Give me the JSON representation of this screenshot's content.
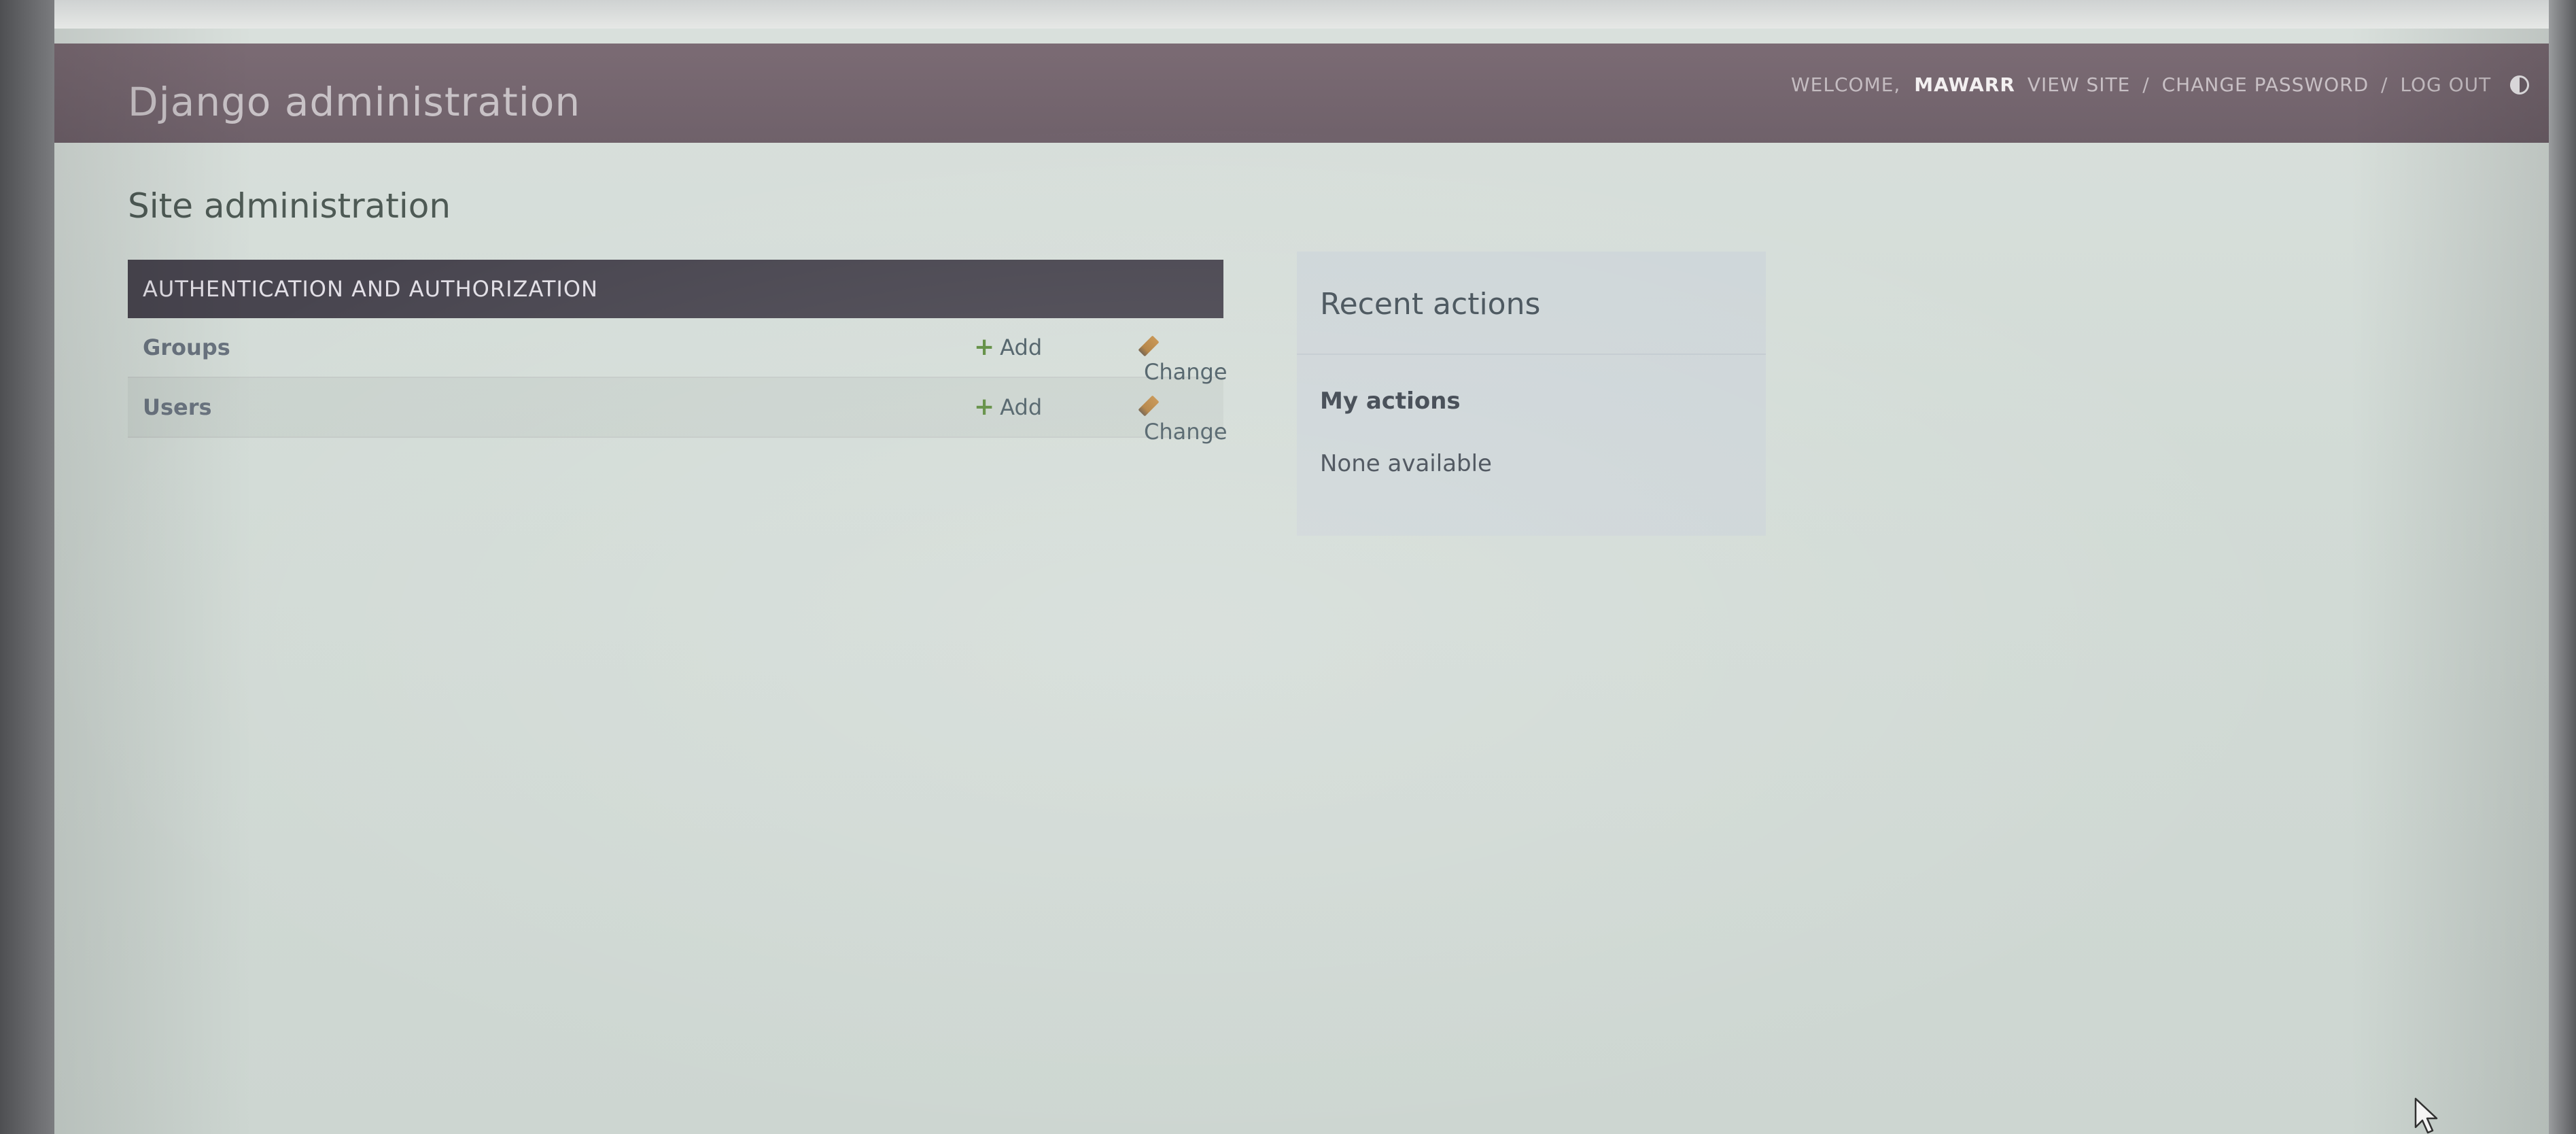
{
  "header": {
    "branding": "Django administration",
    "welcome_label": "WELCOME,",
    "username": "MAWARR",
    "view_site": "VIEW SITE",
    "separator": "/",
    "change_password": "CHANGE PASSWORD",
    "log_out": "LOG OUT",
    "theme_toggle_icon": "half-circle-icon"
  },
  "main": {
    "title": "Site administration",
    "apps": [
      {
        "caption": "AUTHENTICATION AND AUTHORIZATION",
        "models": [
          {
            "name": "Groups",
            "add_label": "Add",
            "change_label": "Change"
          },
          {
            "name": "Users",
            "add_label": "Add",
            "change_label": "Change"
          }
        ]
      }
    ]
  },
  "sidebar": {
    "title": "Recent actions",
    "my_actions_label": "My actions",
    "empty_text": "None available"
  },
  "colors": {
    "header_bg": "#6f616a",
    "module_caption_bg": "#48454f",
    "add_icon": "#5b8a3c",
    "change_icon": "#b07d3a"
  }
}
